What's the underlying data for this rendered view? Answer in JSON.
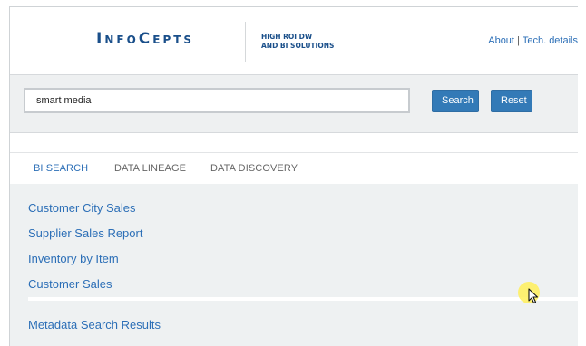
{
  "header": {
    "logo_text": "InfoCepts",
    "tagline_line1": "HIGH ROI DW",
    "tagline_line2": "AND BI SOLUTIONS",
    "links": {
      "about": "About",
      "separator": "|",
      "tech_details": "Tech. details"
    }
  },
  "search": {
    "query": "smart media",
    "search_label": "Search",
    "reset_label": "Reset"
  },
  "tabs": [
    {
      "label": "BI SEARCH",
      "active": true
    },
    {
      "label": "DATA LINEAGE",
      "active": false
    },
    {
      "label": "DATA DISCOVERY",
      "active": false
    }
  ],
  "results": {
    "items": [
      {
        "label": "Customer City Sales"
      },
      {
        "label": "Supplier Sales Report"
      },
      {
        "label": "Inventory by Item"
      },
      {
        "label": "Customer Sales"
      }
    ],
    "metadata_heading": "Metadata Search Results"
  },
  "colors": {
    "brand": "#1a4f8a",
    "link": "#2c6fb7",
    "button": "#337ab7",
    "panel_bg": "#eef0f1",
    "cursor_highlight": "#fff05a"
  },
  "icons": {
    "cursor": "mouse-pointer-icon"
  }
}
